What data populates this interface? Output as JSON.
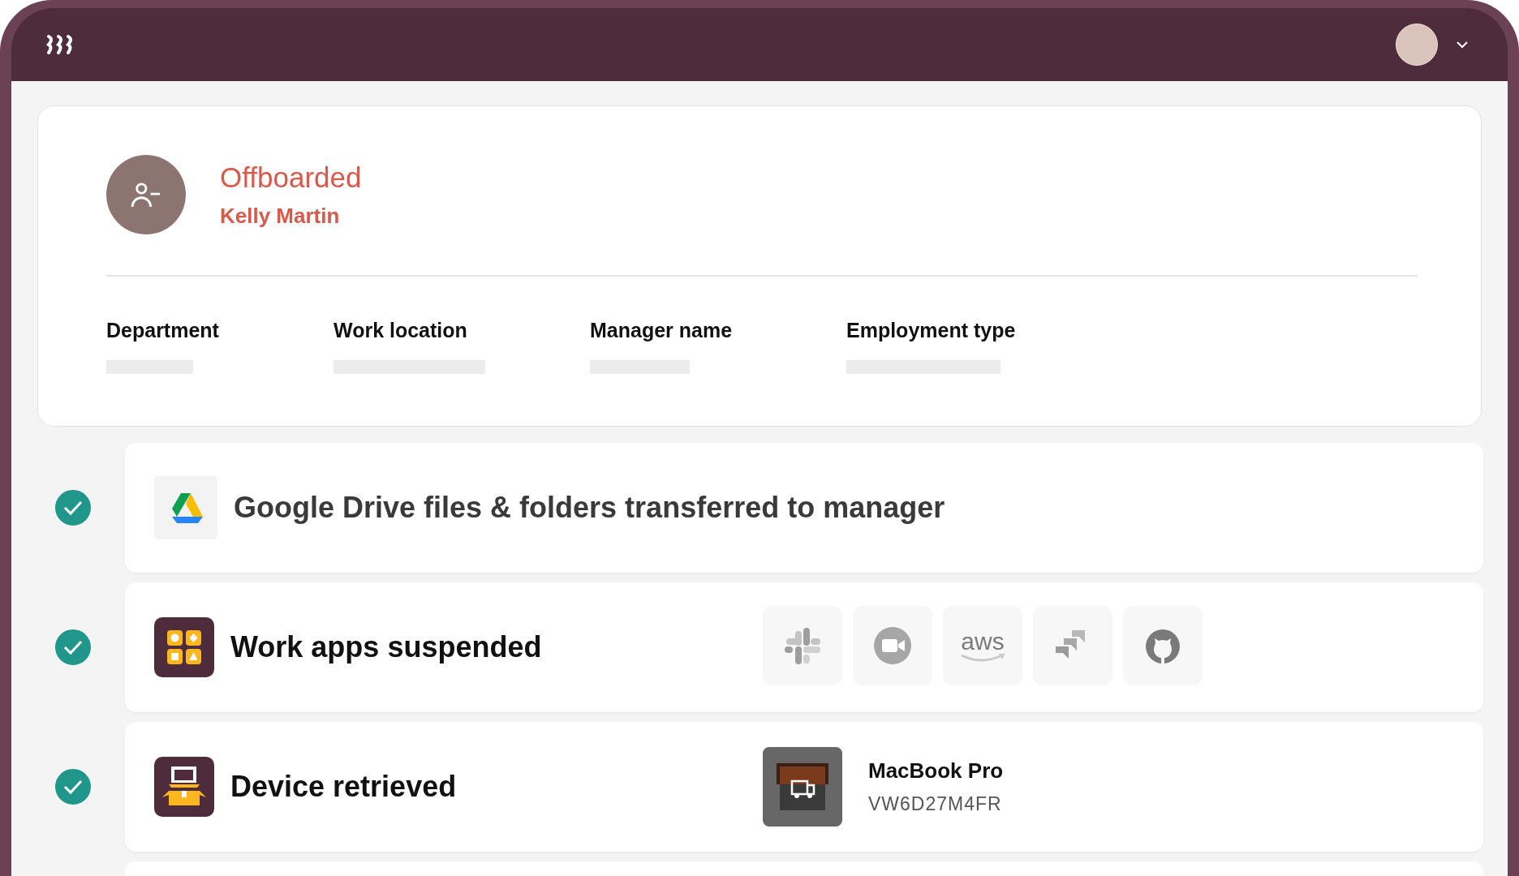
{
  "profile": {
    "status": "Offboarded",
    "name": "Kelly Martin",
    "fields": [
      {
        "label": "Department"
      },
      {
        "label": "Work location"
      },
      {
        "label": "Manager name"
      },
      {
        "label": "Employment type"
      }
    ]
  },
  "tasks": [
    {
      "kind": "drive",
      "done": true,
      "title": "Google Drive files & folders transferred to manager"
    },
    {
      "kind": "apps",
      "done": true,
      "title": "Work apps suspended",
      "apps": [
        {
          "kind": "slack"
        },
        {
          "kind": "zoom"
        },
        {
          "kind": "aws",
          "label": "aws"
        },
        {
          "kind": "jira"
        },
        {
          "kind": "github"
        }
      ]
    },
    {
      "kind": "device",
      "done": true,
      "title": "Device retrieved",
      "device": {
        "name": "MacBook Pro",
        "serial": "VW6D27M4FR"
      }
    }
  ]
}
